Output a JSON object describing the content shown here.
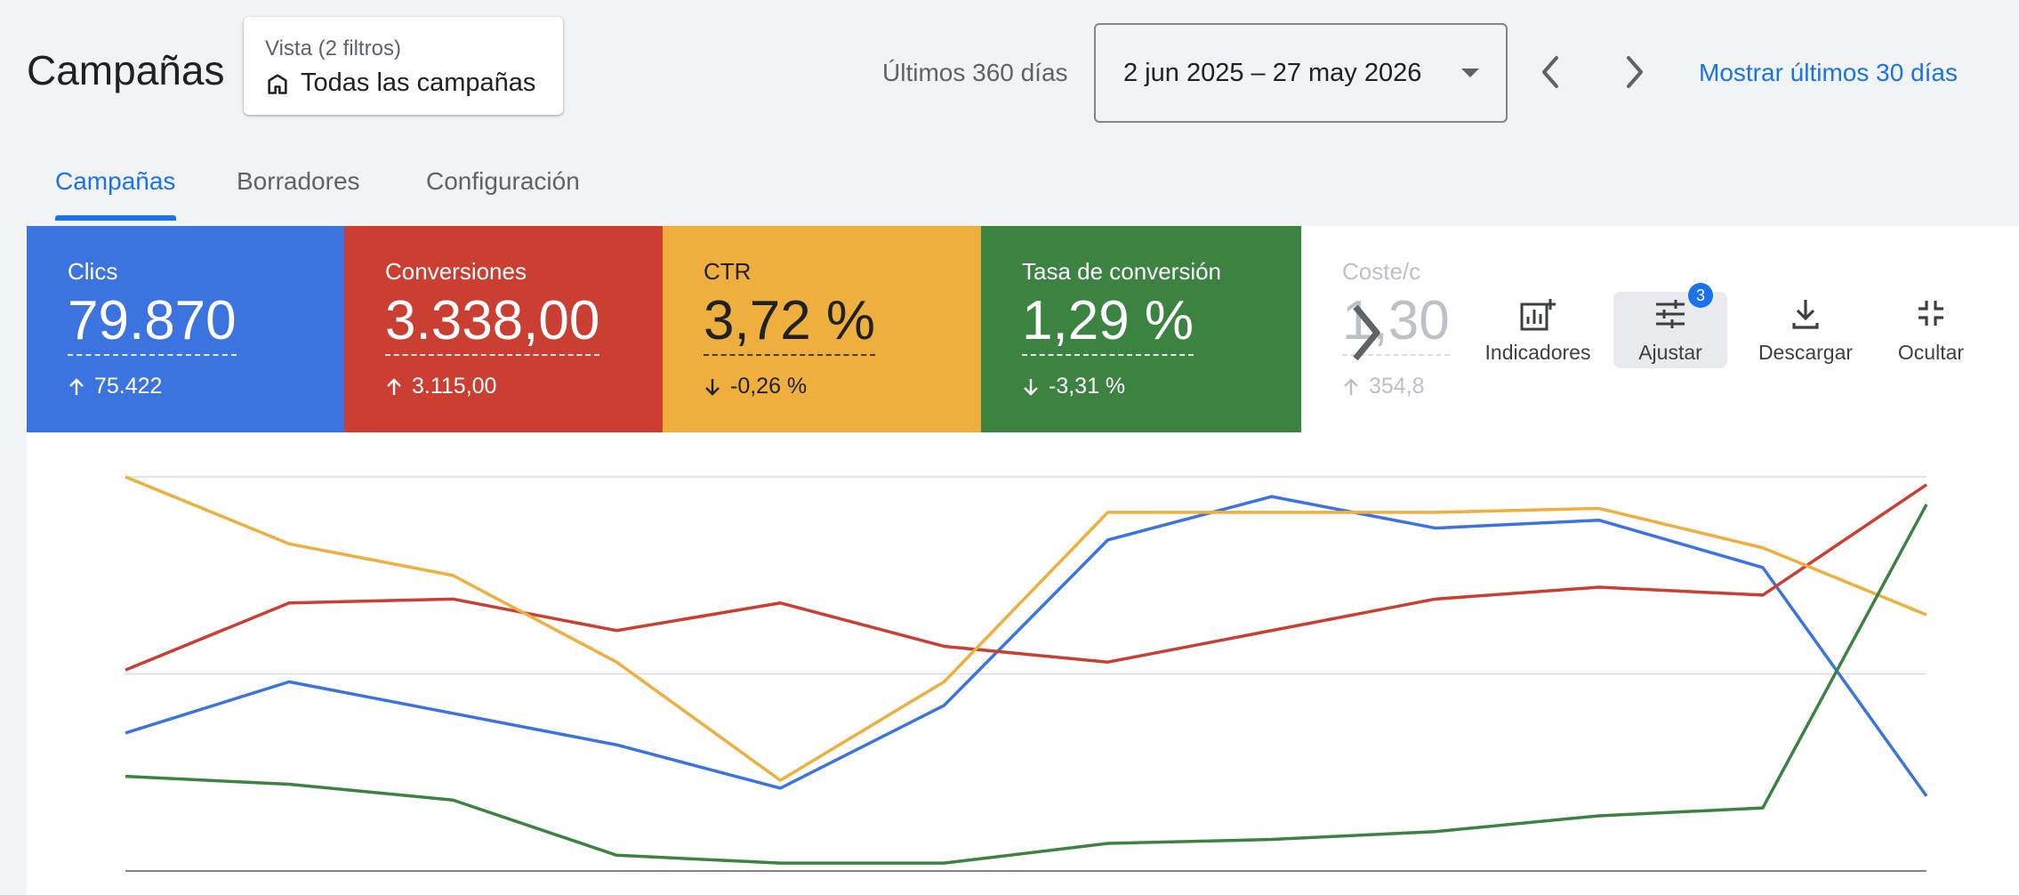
{
  "header": {
    "title": "Campañas",
    "view_filter": {
      "subtitle": "Vista (2 filtros)",
      "selection": "Todas las campañas",
      "icon": "building-icon"
    },
    "range_label": "Últimos 360 días",
    "date_range": "2 jun 2025 – 27 may 2026",
    "show_last_link": "Mostrar últimos 30 días"
  },
  "tabs": [
    {
      "label": "Campañas",
      "active": true
    },
    {
      "label": "Borradores",
      "active": false
    },
    {
      "label": "Configuración",
      "active": false
    }
  ],
  "metrics": [
    {
      "label": "Clics",
      "value": "79.870",
      "change": "75.422",
      "direction": "up",
      "color": "#3b74df"
    },
    {
      "label": "Conversiones",
      "value": "3.338,00",
      "change": "3.115,00",
      "direction": "up",
      "color": "#cb3f33"
    },
    {
      "label": "CTR",
      "value": "3,72 %",
      "change": "-0,26 %",
      "direction": "down",
      "color": "#eeaf3e"
    },
    {
      "label": "Tasa de conversión",
      "value": "1,29 %",
      "change": "-3,31 %",
      "direction": "down",
      "color": "#3c8241"
    },
    {
      "label": "Coste/c",
      "value": "1,30",
      "change": "354,8",
      "direction": "up",
      "color": "#ffffff"
    }
  ],
  "toolbar": {
    "indicators": "Indicadores",
    "adjust": "Ajustar",
    "adjust_badge": "3",
    "download": "Descargar",
    "hide": "Ocultar"
  },
  "chart_data": {
    "type": "line",
    "x": [
      1,
      2,
      3,
      4,
      5,
      6,
      7,
      8,
      9,
      10,
      11,
      12
    ],
    "ylim": [
      0,
      100
    ],
    "grid": true,
    "series": [
      {
        "name": "Clics",
        "color": "#3b74df",
        "values": [
          35,
          48,
          40,
          32,
          21,
          42,
          84,
          95,
          87,
          89,
          77,
          19
        ]
      },
      {
        "name": "Conversiones",
        "color": "#cb3f33",
        "values": [
          51,
          68,
          69,
          61,
          68,
          57,
          53,
          61,
          69,
          72,
          70,
          98
        ]
      },
      {
        "name": "CTR",
        "color": "#eeaf3e",
        "values": [
          100,
          83,
          75,
          53,
          23,
          48,
          91,
          91,
          91,
          92,
          82,
          65
        ]
      },
      {
        "name": "Tasa de conversión",
        "color": "#3c8241",
        "values": [
          24,
          22,
          18,
          4,
          2,
          2,
          7,
          8,
          10,
          14,
          16,
          93
        ]
      }
    ]
  }
}
